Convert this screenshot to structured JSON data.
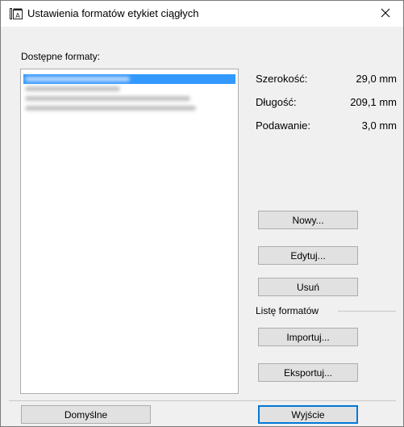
{
  "window": {
    "title": "Ustawienia formatów etykiet ciągłych"
  },
  "formats_list": {
    "label": "Dostępne formaty:",
    "items": [
      {
        "label": "[obscured]",
        "selected": true
      },
      {
        "label": "[obscured]",
        "selected": false
      },
      {
        "label": "[obscured]",
        "selected": false
      },
      {
        "label": "[obscured]",
        "selected": false
      }
    ]
  },
  "properties": {
    "width_label": "Szerokość:",
    "width_value": "29,0 mm",
    "length_label": "Długość:",
    "length_value": "209,1 mm",
    "feed_label": "Podawanie:",
    "feed_value": "3,0 mm"
  },
  "buttons": {
    "new": "Nowy...",
    "edit": "Edytuj...",
    "delete": "Usuń",
    "import": "Importuj...",
    "export": "Eksportuj...",
    "default": "Domyślne",
    "exit": "Wyjście"
  },
  "formats_group": {
    "label": "Listę formatów"
  },
  "icons": {
    "title_icon": "label-format-icon",
    "close_icon": "close-icon"
  },
  "colors": {
    "selection": "#3399ff",
    "default_button_border": "#0078d7",
    "dialog_bg": "#f0f0f0"
  }
}
